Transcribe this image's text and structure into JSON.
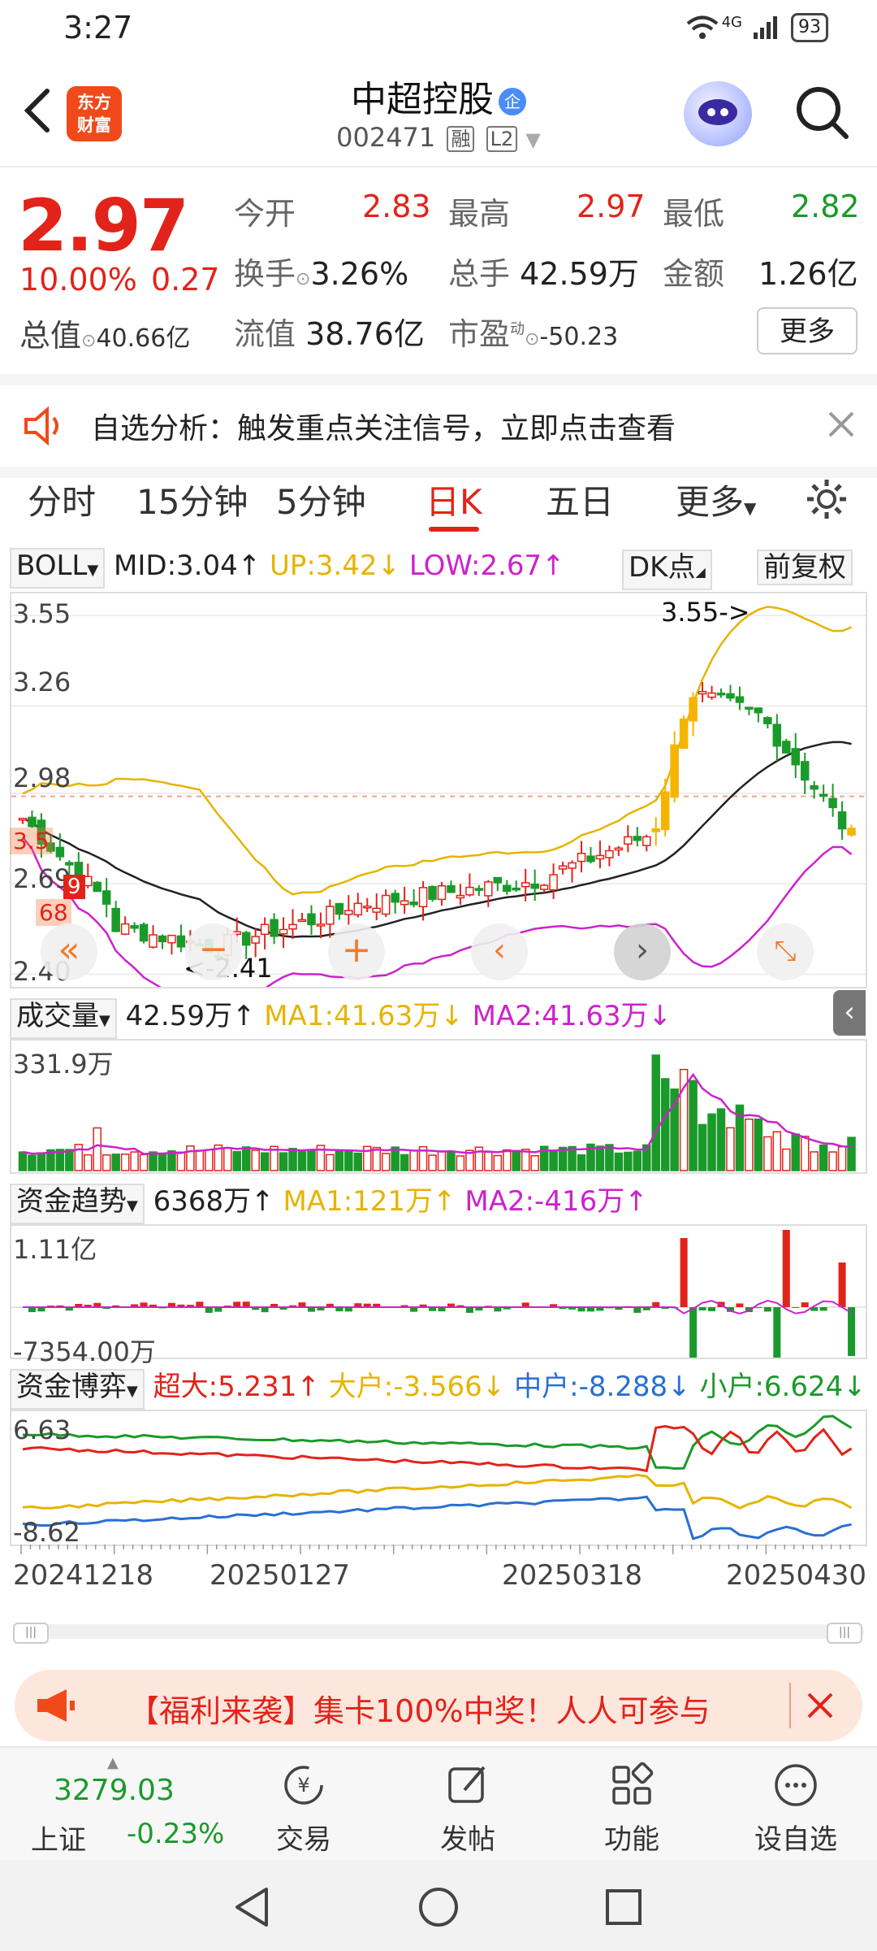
{
  "status_bar": {
    "time": "3:27",
    "network": "4G",
    "battery": "93"
  },
  "header": {
    "logo_line1": "东方",
    "logo_line2": "财富",
    "stock_name": "中超控股",
    "badge": "企",
    "stock_code": "002471",
    "tag_margin": "融",
    "tag_level": "L2"
  },
  "quote": {
    "price": "2.97",
    "change_pct": "10.00%",
    "change_abs": "0.27",
    "open_label": "今开",
    "open": "2.83",
    "high_label": "最高",
    "high": "2.97",
    "low_label": "最低",
    "low": "2.82",
    "turnover_label": "换手",
    "turnover": "3.26%",
    "volume_label": "总手",
    "volume": "42.59万",
    "amount_label": "金额",
    "amount": "1.26亿",
    "mktcap_label": "总值",
    "mktcap": "40.66亿",
    "float_label": "流值",
    "float_val": "38.76亿",
    "pe_label": "市盈",
    "pe_sup": "动",
    "pe": "-50.23",
    "more_label": "更多"
  },
  "notice": {
    "text": "自选分析：触发重点关注信号，立即点击查看"
  },
  "tabs": [
    {
      "label": "分时"
    },
    {
      "label": "15分钟"
    },
    {
      "label": "5分钟"
    },
    {
      "label": "日K"
    },
    {
      "label": "五日"
    },
    {
      "label": "更多"
    }
  ],
  "boll": {
    "name": "BOLL",
    "mid": "MID:3.04↑",
    "up": "UP:3.42↓",
    "low": "LOW:2.67↑",
    "dk": "DK点",
    "fq": "前复权",
    "y_labels": [
      "3.55",
      "3.26",
      "2.98",
      "2.69",
      "2.40"
    ],
    "max_label": "3.55->",
    "min_label": "<-2.41",
    "marker_35": "3.5",
    "marker_68": "68",
    "marker_9": "9"
  },
  "volume": {
    "name": "成交量",
    "value": "42.59万↑",
    "ma1": "MA1:41.63万↓",
    "ma2": "MA2:41.63万↓",
    "y_max": "331.9万"
  },
  "fund_trend": {
    "name": "资金趋势",
    "value": "6368万↑",
    "ma1": "MA1:121万↑",
    "ma2": "MA2:-416万↑",
    "y_max": "1.11亿",
    "y_min": "-7354.00万"
  },
  "fund_game": {
    "name": "资金博弈",
    "super": "超大:5.231↑",
    "big": "大户:-3.566↓",
    "mid": "中户:-8.288↓",
    "small": "小户:6.624↓",
    "y_max": "6.63",
    "y_min": "-8.62"
  },
  "dates": [
    "20241218",
    "20250127",
    "20250318",
    "20250430"
  ],
  "banner": {
    "text": "【福利来袭】集卡100%中奖！人人可参与"
  },
  "bottom": {
    "index_value": "3279.03",
    "index_name": "上证",
    "index_change": "-0.23%",
    "items": [
      {
        "label": "交易"
      },
      {
        "label": "发帖"
      },
      {
        "label": "功能"
      },
      {
        "label": "设自选"
      }
    ]
  },
  "colors": {
    "up": "#e2231a",
    "down": "#1a9a2a",
    "boll_up": "#e6b400",
    "boll_low": "#cc22cc",
    "accent": "#f04a1b"
  }
}
